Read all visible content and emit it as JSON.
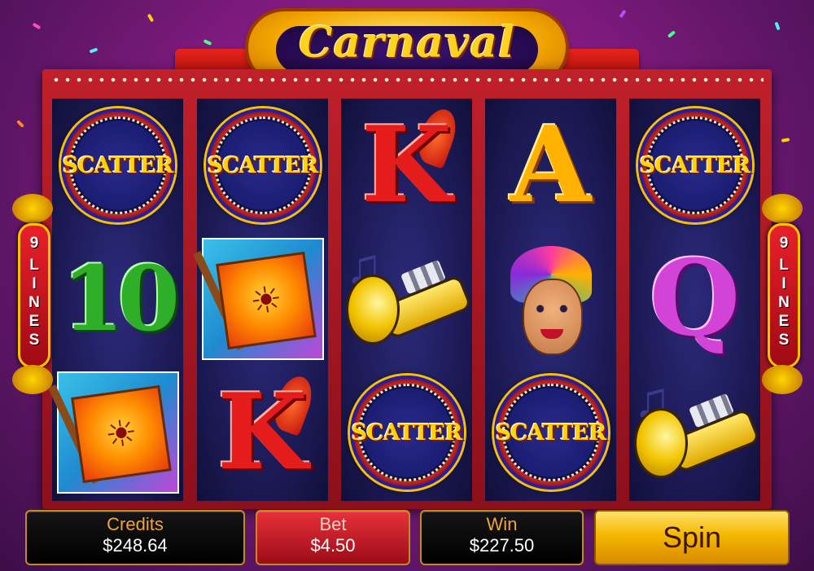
{
  "game": {
    "title": "Carnaval",
    "colors": {
      "background": "#8a1c86",
      "frame": "#c0202a",
      "reel": "#1a1850",
      "gold": "#ffd400"
    }
  },
  "paylines": {
    "left_label": "9 LINES",
    "right_label": "9 LINES"
  },
  "reels": [
    {
      "symbols": [
        "SCATTER",
        "10",
        "banner-flag"
      ]
    },
    {
      "symbols": [
        "SCATTER",
        "banner-flag",
        "K"
      ]
    },
    {
      "symbols": [
        "K",
        "trumpet",
        "SCATTER"
      ]
    },
    {
      "symbols": [
        "A",
        "carnival-dancer",
        "SCATTER"
      ]
    },
    {
      "symbols": [
        "SCATTER",
        "Q",
        "trumpet"
      ]
    }
  ],
  "symbol_text": {
    "scatter": "SCATTER",
    "ten": "10",
    "king": "K",
    "ace": "A",
    "queen": "Q"
  },
  "bottom_bar": {
    "credits": {
      "label": "Credits",
      "value": "$248.64"
    },
    "bet": {
      "label": "Bet",
      "value": "$4.50"
    },
    "win": {
      "label": "Win",
      "value": "$227.50"
    },
    "spin_label": "Spin"
  }
}
